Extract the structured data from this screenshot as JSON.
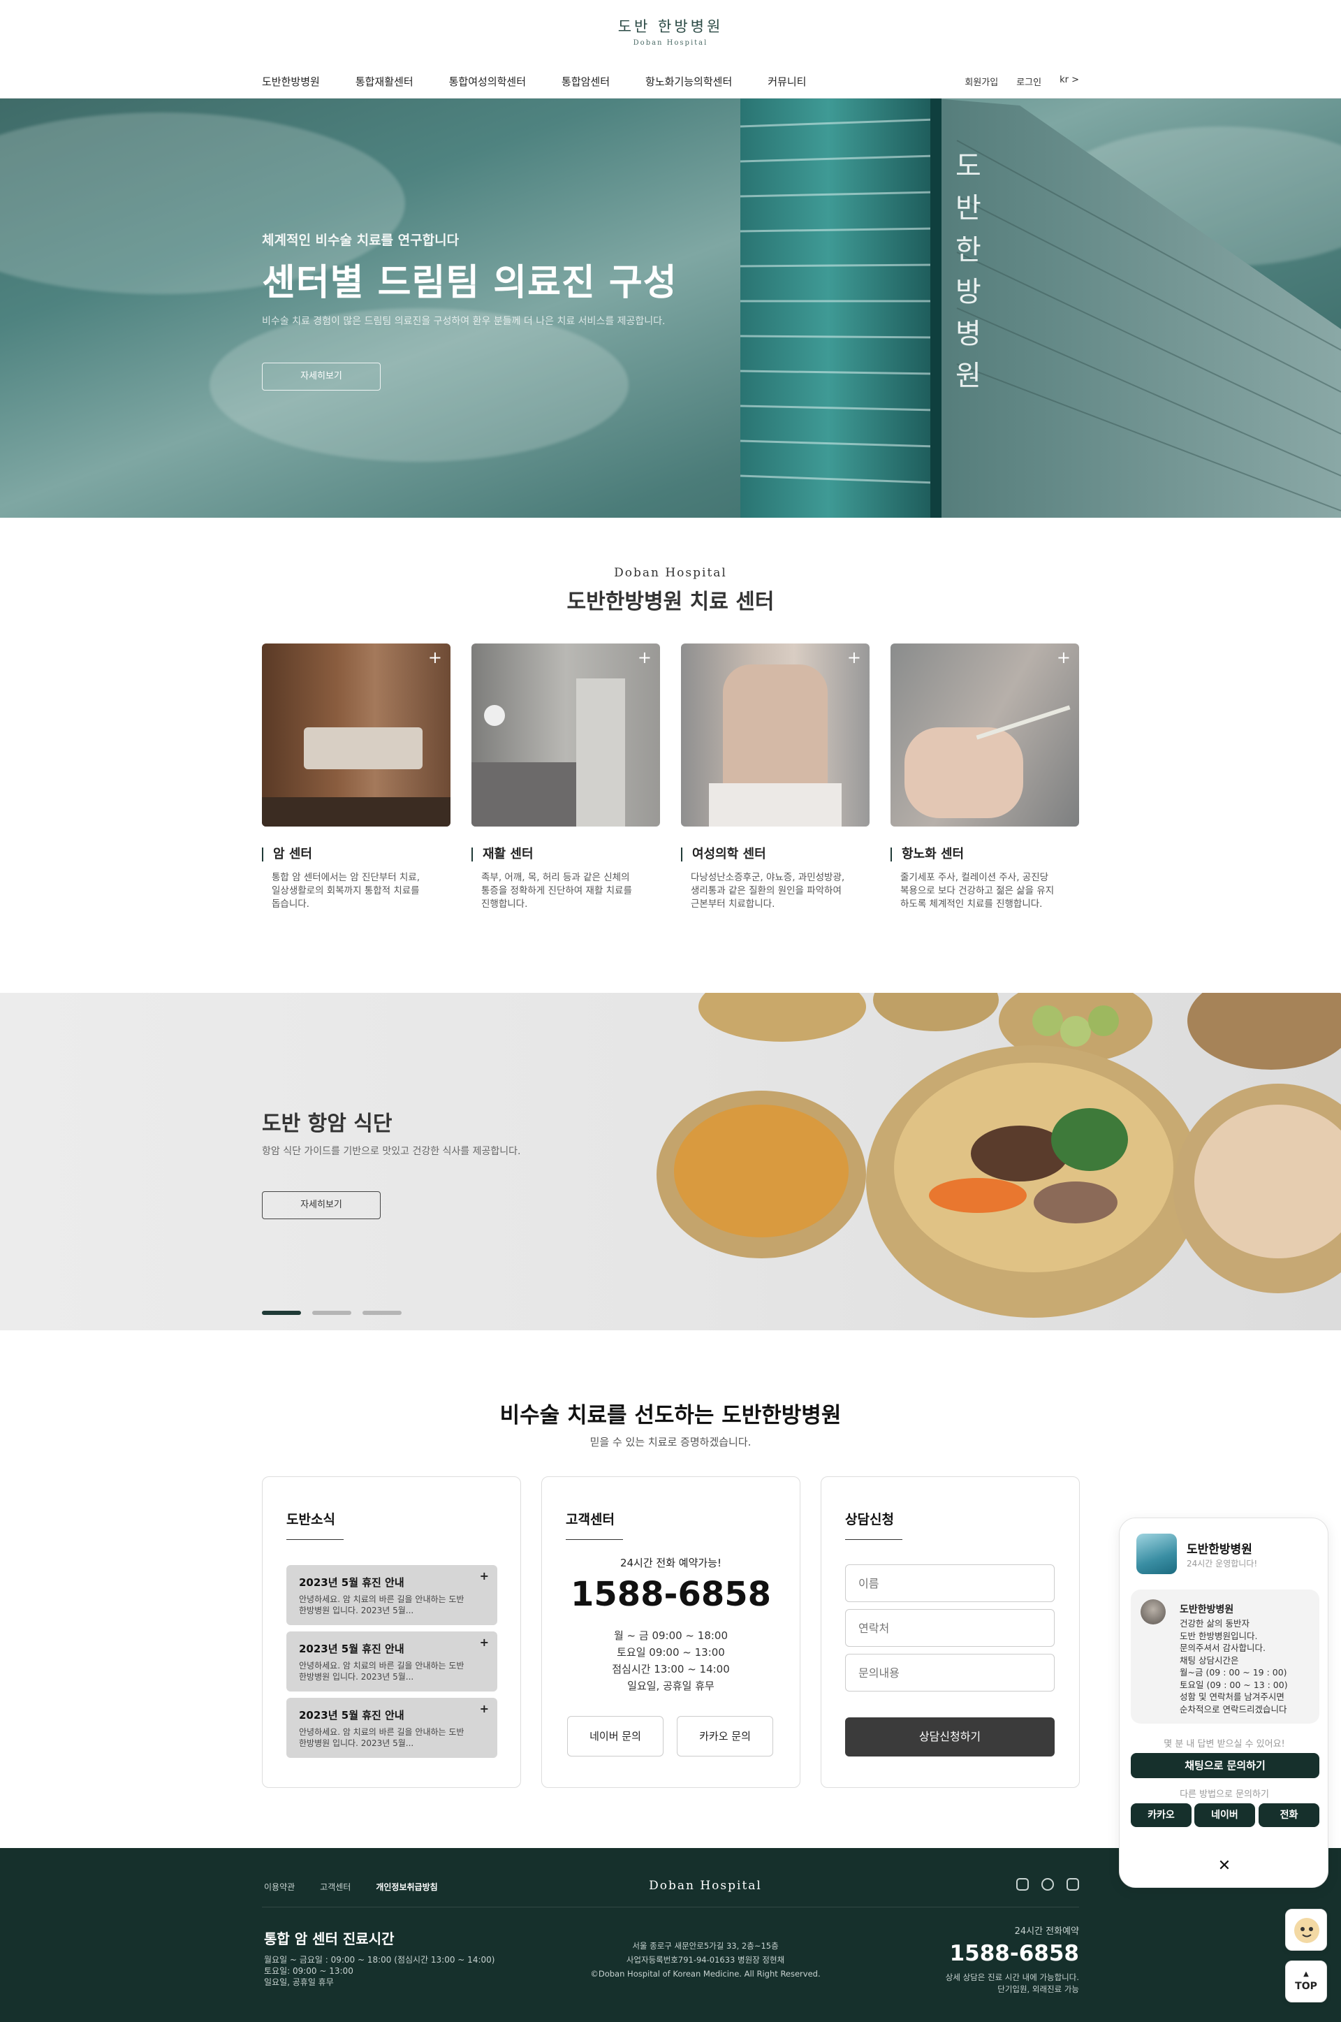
{
  "header": {
    "logo_ko": "도반 한방병원",
    "logo_en": "Doban Hospital",
    "nav": [
      "도반한방병원",
      "통합재활센터",
      "통합여성의학센터",
      "통합암센터",
      "항노화기능의학센터",
      "커뮤니티"
    ],
    "util": [
      "회원가입",
      "로그인",
      "kr >"
    ]
  },
  "hero": {
    "sub": "체계적인 비수술 치료를 연구합니다",
    "title": "센터별 드림팀 의료진 구성",
    "desc": "비수술 치료 경험이 많은 드림팀 의료진을 구성하여 환우 분들께 더 나은 치료 서비스를 제공합니다.",
    "button": "자세히보기",
    "building_sign": "도반한방병원"
  },
  "centers": {
    "en": "Doban Hospital",
    "title": "도반한방병원 치료 센터",
    "items": [
      {
        "title": "암 센터",
        "desc": [
          "통합 암 센터에서는 암 진단부터 치료,",
          "일상생활로의 회복까지 통합적 치료를",
          "돕습니다."
        ]
      },
      {
        "title": "재활 센터",
        "desc": [
          "족부, 어깨, 목, 허리 등과 같은 신체의",
          "통증을 정확하게 진단하여 재활 치료를",
          "진행합니다."
        ]
      },
      {
        "title": "여성의학 센터",
        "desc": [
          "다낭성난소증후군, 야뇨증, 과민성방광,",
          "생리통과 같은 질환의 원인을 파악하여",
          "근본부터 치료합니다."
        ]
      },
      {
        "title": "항노화 센터",
        "desc": [
          "줄기세포 주사, 컬레이션 주사, 공진당",
          "복용으로 보다 건강하고 젊은 삶을 유지",
          "하도록 체계적인 치료를 진행합니다."
        ]
      }
    ],
    "plus": "+"
  },
  "diet": {
    "title": "도반 항암 식단",
    "desc": "항암 식단 가이드를 기반으로 맛있고 건강한 식사를 제공합니다.",
    "button": "자세히보기",
    "slides": 3,
    "active_slide": 1
  },
  "info": {
    "title": "비수술 치료를 선도하는 도반한방병원",
    "sub": "믿을 수 있는 치료로 증명하겠습니다.",
    "news": {
      "title": "도반소식",
      "items": [
        {
          "title": "2023년 5월 휴진 안내",
          "desc": [
            "안녕하세요. 암 치료의 바른 길을 안내하는 도반",
            "한방병원 입니다. 2023년 5월..."
          ]
        },
        {
          "title": "2023년 5월 휴진 안내",
          "desc": [
            "안녕하세요. 암 치료의 바른 길을 안내하는 도반",
            "한방병원 입니다. 2023년 5월..."
          ]
        },
        {
          "title": "2023년 5월 휴진 안내",
          "desc": [
            "안녕하세요. 암 치료의 바른 길을 안내하는 도반",
            "한방병원 입니다. 2023년 5월..."
          ]
        }
      ]
    },
    "cs": {
      "title": "고객센터",
      "label": "24시간 전화 예약가능!",
      "phone": "1588-6858",
      "hours": [
        "월 ~ 금 09:00 ~ 18:00",
        "토요일 09:00 ~ 13:00",
        "점심시간 13:00 ~ 14:00",
        "일요일, 공휴일 휴무"
      ],
      "naver": "네이버 문의",
      "kakao": "카카오 문의"
    },
    "consult": {
      "title": "상담신청",
      "name_ph": "이름",
      "phone_ph": "연락처",
      "msg_ph": "문의내용",
      "submit": "상담신청하기"
    }
  },
  "footer": {
    "links": [
      "이용약관",
      "고객센터",
      "개인정보취급방침"
    ],
    "logo": "Doban Hospital",
    "title": "통합 암 센터 진료시간",
    "hours": [
      "월요일 ~ 금요일 : 09:00 ~ 18:00 (점심시간 13:00 ~ 14:00)",
      "토요일: 09:00 ~ 13:00",
      "일요일, 공휴일 휴무"
    ],
    "address": [
      "서울 종로구 새문안로5가길 33, 2층~15층",
      "사업자등록번호791-94-01633 병원장 정현채",
      "©Doban Hospital of Korean Medicine. All Right Reserved."
    ],
    "phone_label": "24시간 전화예약",
    "phone": "1588-6858",
    "note": [
      "상세 상담은 진료 시간 내에 가능합니다.",
      "단기입원, 외래진료 가능"
    ]
  },
  "chat": {
    "name": "도반한방병원",
    "status": "24시간 운영합니다!",
    "bubble_name": "도반한방병원",
    "bubble_text": [
      "건강한 삶의 동반자",
      "도반 한방병원입니다.",
      "문의주셔서 감사합니다.",
      "채팅 상담시간은",
      "월~금 (09 : 00 ~ 19 : 00)",
      "토요일 (09 : 00 ~ 13 : 00)",
      "성함 및 연락처를 남겨주시면",
      "순차적으로 연락드리겠습니다"
    ],
    "reply_time": "몇 분 내 답변 받으실 수 있어요!",
    "chat_button": "채팅으로 문의하기",
    "other": "다른 방법으로 문의하기",
    "options": [
      "카카오",
      "네이버",
      "전화"
    ],
    "close": "✕"
  },
  "floating": {
    "top": "TOP"
  },
  "colors": {
    "accent": "#16302c",
    "hero_teal": "#4f8380",
    "panel_border": "#dddddd"
  }
}
